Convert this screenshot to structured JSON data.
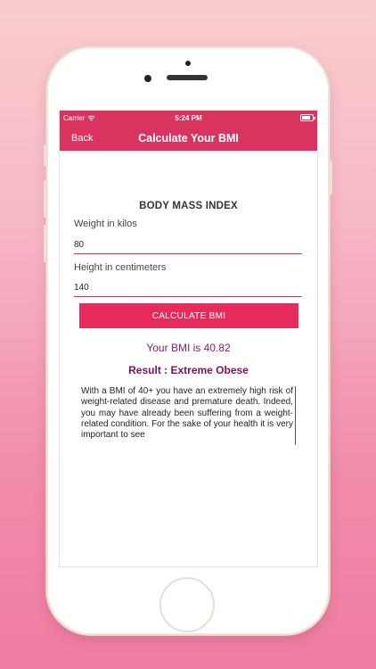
{
  "status_bar": {
    "carrier": "Carrier",
    "time": "5:24 PM",
    "battery_level": 0.8
  },
  "nav": {
    "back_label": "Back",
    "title": "Calculate Your BMI"
  },
  "form": {
    "section_title": "BODY MASS INDEX",
    "weight_label": "Weight in kilos",
    "weight_value": "80",
    "height_label": "Height in centimeters",
    "height_value": "140",
    "calculate_label": "CALCULATE BMI"
  },
  "result": {
    "bmi_text": "Your BMI is 40.82",
    "category_text": "Result : Extreme Obese",
    "description": "With a BMI of 40+ you have an extremely high risk of weight-related disease and premature death. Indeed, you may have already been suffering from a weight-related condition. For the sake of your health it is very important to see"
  },
  "colors": {
    "accent": "#d9335f",
    "button": "#e62a5c",
    "result_text": "#7b0f5e"
  }
}
